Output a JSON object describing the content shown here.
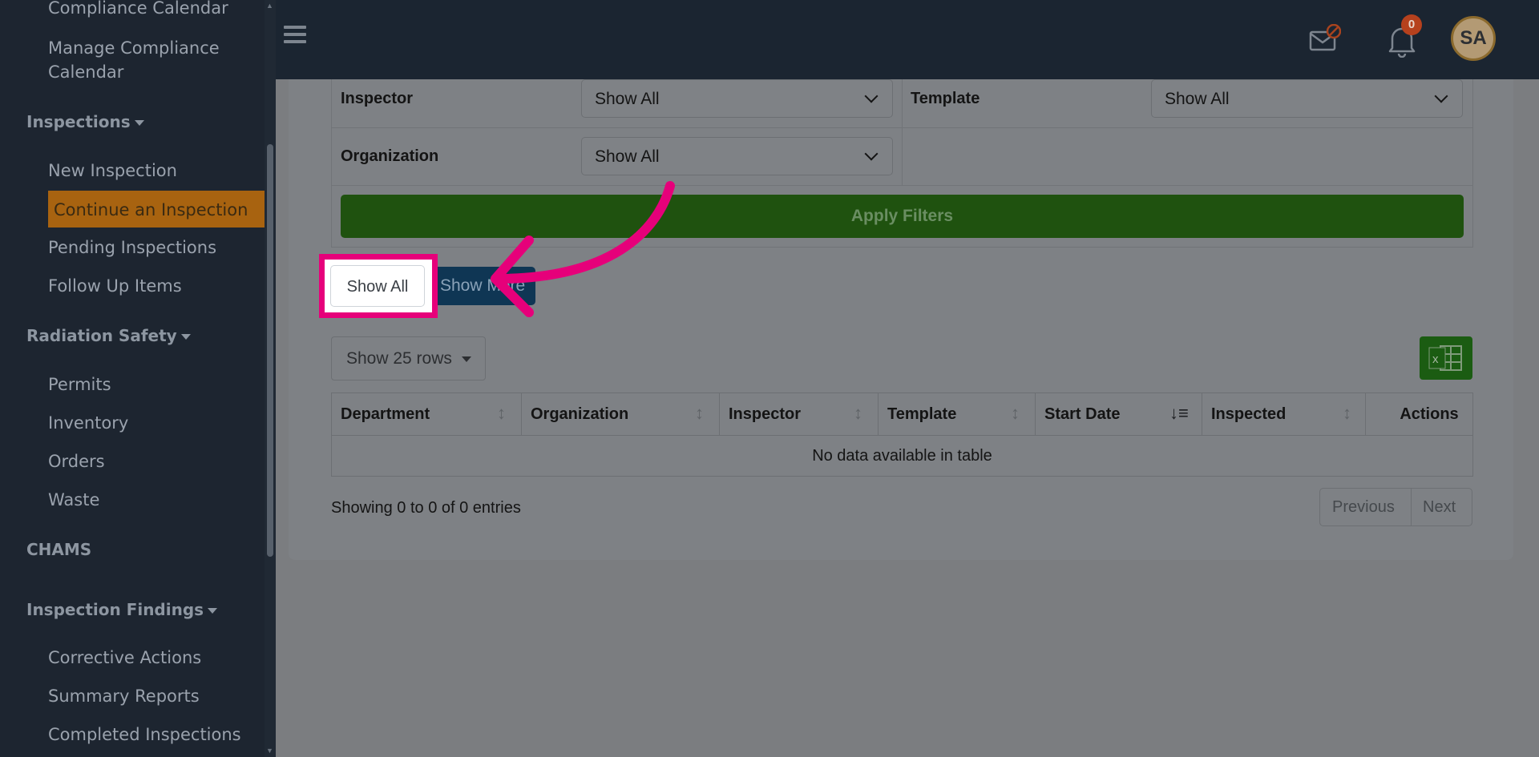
{
  "sidebar": {
    "items_top": [
      "Compliance Calendar",
      "Manage Compliance",
      "Calendar"
    ],
    "sections": {
      "inspections": "Inspections",
      "radiation": "Radiation Safety",
      "chams": "CHAMS",
      "findings": "Inspection Findings"
    },
    "inspections_items": [
      "New Inspection",
      "Continue an Inspection",
      "Pending Inspections",
      "Follow Up Items"
    ],
    "radiation_items": [
      "Permits",
      "Inventory",
      "Orders",
      "Waste"
    ],
    "findings_items": [
      "Corrective Actions",
      "Summary Reports",
      "Completed Inspections"
    ]
  },
  "header": {
    "notification_count": "0",
    "avatar_initials": "SA"
  },
  "filters": {
    "inspector_label": "Inspector",
    "inspector_value": "Show All",
    "template_label": "Template",
    "template_value": "Show All",
    "organization_label": "Organization",
    "organization_value": "Show All",
    "apply_label": "Apply Filters"
  },
  "toggles": {
    "show_all": "Show All",
    "show_more": "Show More"
  },
  "table": {
    "rows_label": "Show 25 rows",
    "columns": [
      "Department",
      "Organization",
      "Inspector",
      "Template",
      "Start Date",
      "Inspected",
      "Actions"
    ],
    "empty_text": "No data available in table",
    "info_text": "Showing 0 to 0 of 0 entries",
    "previous": "Previous",
    "next": "Next"
  },
  "colors": {
    "highlight": "#e6007a",
    "active_item": "#a86310",
    "apply": "#1f520f"
  }
}
